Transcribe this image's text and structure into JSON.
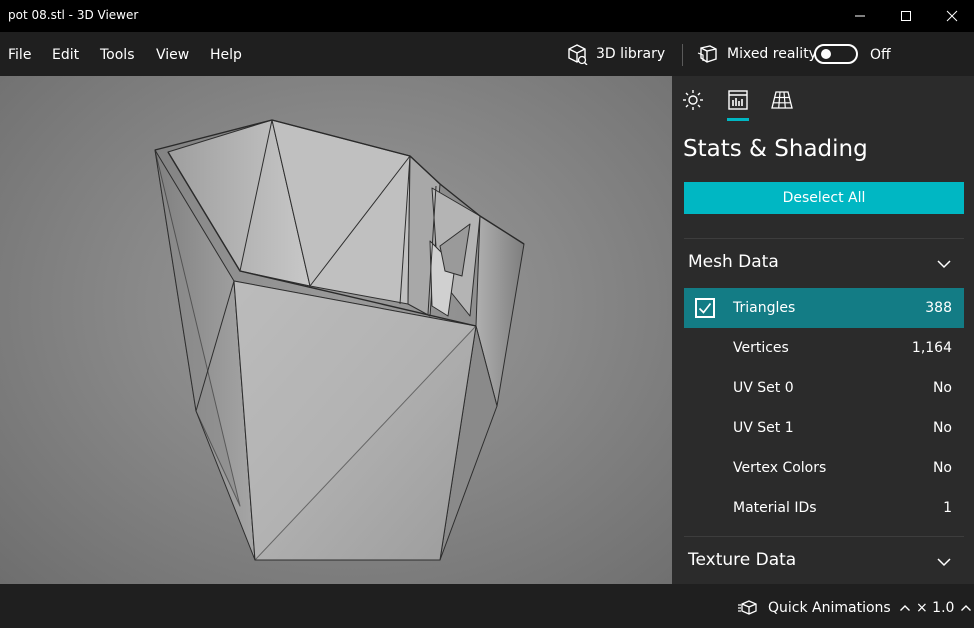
{
  "window": {
    "title": "pot 08.stl - 3D Viewer"
  },
  "menu": [
    "File",
    "Edit",
    "Tools",
    "View",
    "Help"
  ],
  "toolbar": {
    "library_label": "3D library",
    "mixed_reality_label": "Mixed reality",
    "mixed_reality_state": "Off"
  },
  "panel": {
    "tabs": [
      "environment-icon",
      "stats-icon",
      "grid-icon"
    ],
    "title": "Stats & Shading",
    "deselect_label": "Deselect All",
    "mesh_section": "Mesh Data",
    "mesh_rows": [
      {
        "label": "Triangles",
        "value": "388",
        "checked": true
      },
      {
        "label": "Vertices",
        "value": "1,164"
      },
      {
        "label": "UV Set 0",
        "value": "No"
      },
      {
        "label": "UV Set 1",
        "value": "No"
      },
      {
        "label": "Vertex Colors",
        "value": "No"
      },
      {
        "label": "Material IDs",
        "value": "1"
      }
    ],
    "texture_section": "Texture Data"
  },
  "status": {
    "quick_animations_label": "Quick Animations",
    "speed_label": "× 1.0"
  },
  "colors": {
    "accent": "#00b7c3",
    "selected_row": "#137c85",
    "panel_bg": "#2b2b2b",
    "chrome_bg": "#1f1f1f",
    "titlebar_bg": "#000000"
  }
}
